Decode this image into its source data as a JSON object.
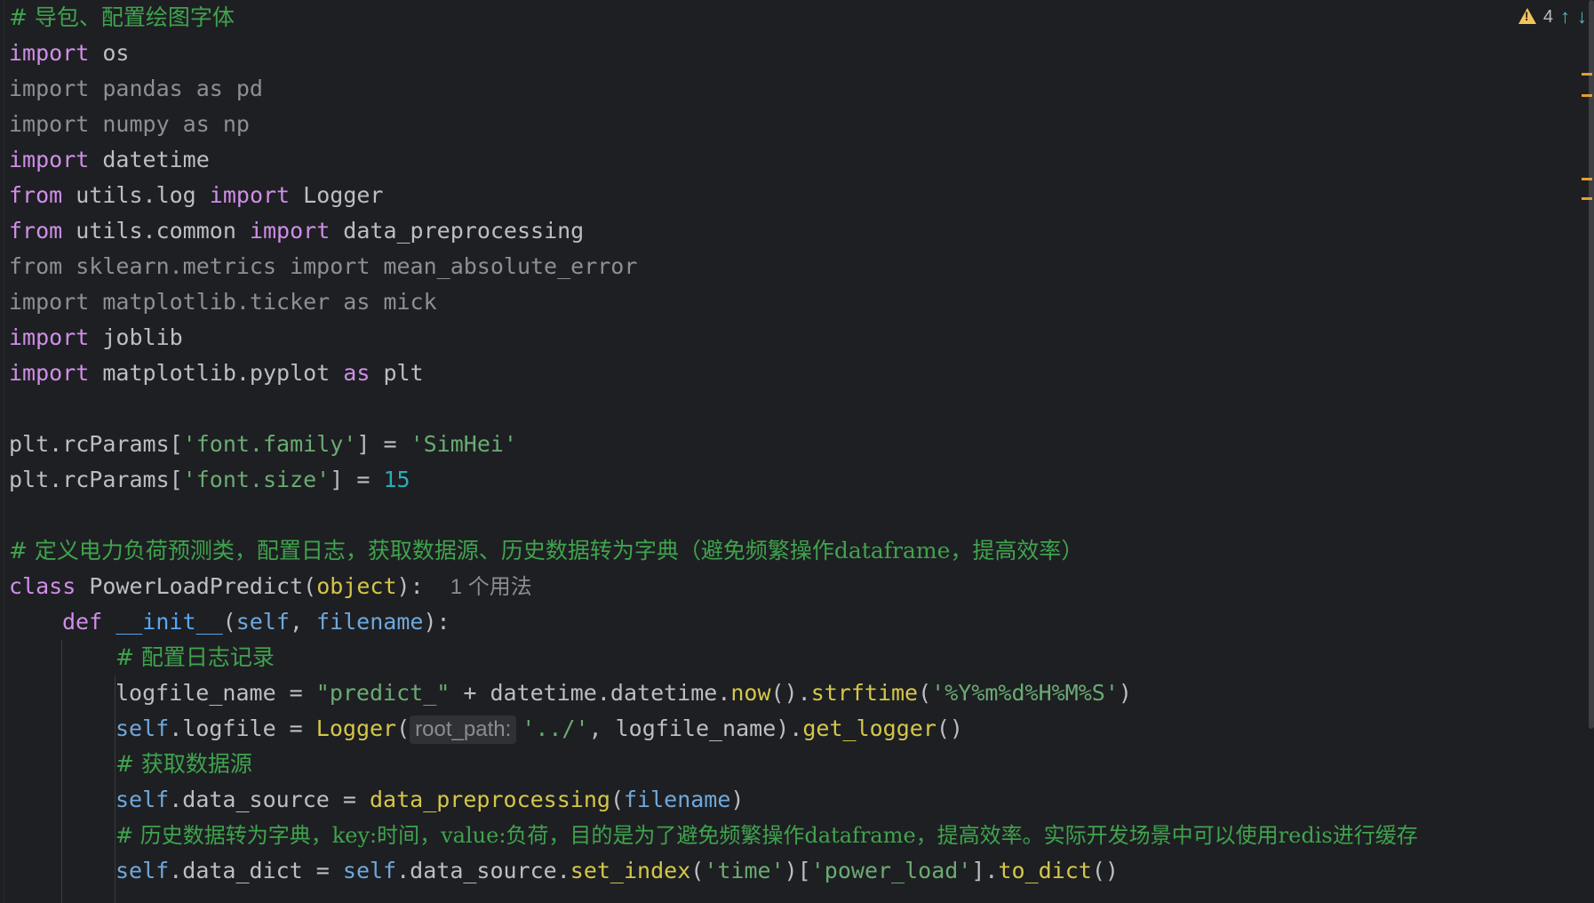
{
  "editor": {
    "warnings_count": "4",
    "lines": {
      "l0_comment": "# 导包、配置绘图字体",
      "l1_kw": "import",
      "l1_rest": " os",
      "l2": "import pandas as pd",
      "l3": "import numpy as np",
      "l4_kw": "import",
      "l4_rest": " datetime",
      "l5_kw1": "from",
      "l5_mid": " utils.log ",
      "l5_kw2": "import",
      "l5_rest": " Logger",
      "l6_kw1": "from",
      "l6_mid": " utils.common ",
      "l6_kw2": "import",
      "l6_rest": " data_preprocessing",
      "l7": "from sklearn.metrics import mean_absolute_error",
      "l8": "import matplotlib.ticker as mick",
      "l9_kw": "import",
      "l9_rest": " joblib",
      "l10_kw": "import",
      "l10_mid": " matplotlib.pyplot ",
      "l10_kw2": "as",
      "l10_rest": " plt",
      "l12_a": "plt.rcParams[",
      "l12_str": "'font.family'",
      "l12_b": "] = ",
      "l12_val": "'SimHei'",
      "l13_a": "plt.rcParams[",
      "l13_str": "'font.size'",
      "l13_b": "] = ",
      "l13_val": "15",
      "l15_comment": "# 定义电力负荷预测类，配置日志，获取数据源、历史数据转为字典（避免频繁操作dataframe，提高效率）",
      "l16_kw": "class",
      "l16_name": " PowerLoadPredict(",
      "l16_base": "object",
      "l16_end": "):",
      "l16_usage": "1 个用法",
      "l17_kw": "def",
      "l17_fn": " __init__",
      "l17_a": "(",
      "l17_self": "self",
      "l17_b": ", ",
      "l17_param": "filename",
      "l17_c": "):",
      "l18_comment": "# 配置日志记录",
      "l19_a": "logfile_name = ",
      "l19_str": "\"predict_\"",
      "l19_b": " + datetime.datetime.",
      "l19_fn1": "now",
      "l19_c": "().",
      "l19_fn2": "strftime",
      "l19_d": "(",
      "l19_str2": "'%Y%m%d%H%M%S'",
      "l19_e": ")",
      "l20_self": "self",
      "l20_a": ".logfile = ",
      "l20_fn": "Logger",
      "l20_b": "(",
      "l20_hint": "root_path:",
      "l20_str": "'../'",
      "l20_c": ", logfile_name).",
      "l20_fn2": "get_logger",
      "l20_d": "()",
      "l21_comment": "# 获取数据源",
      "l22_self": "self",
      "l22_a": ".data_source = ",
      "l22_fn": "data_preprocessing",
      "l22_b": "(",
      "l22_param": "filename",
      "l22_c": ")",
      "l23_comment": "# 历史数据转为字典，key:时间，value:负荷，目的是为了避免频繁操作dataframe，提高效率。实际开发场景中可以使用redis进行缓存",
      "l24_self": "self",
      "l24_a": ".data_dict = ",
      "l24_self2": "self",
      "l24_b": ".data_source.",
      "l24_fn": "set_index",
      "l24_c": "(",
      "l24_str": "'time'",
      "l24_d": ")[",
      "l24_str2": "'power_load'",
      "l24_e": "].",
      "l24_fn2": "to_dict",
      "l24_f": "()"
    }
  },
  "colors": {
    "background": "#1e1f22",
    "keyword": "#cf8ee8",
    "string": "#6aab73",
    "comment": "#3fa34d",
    "number": "#2aacb8",
    "function": "#d4c74a",
    "warning": "#f2c55c"
  }
}
